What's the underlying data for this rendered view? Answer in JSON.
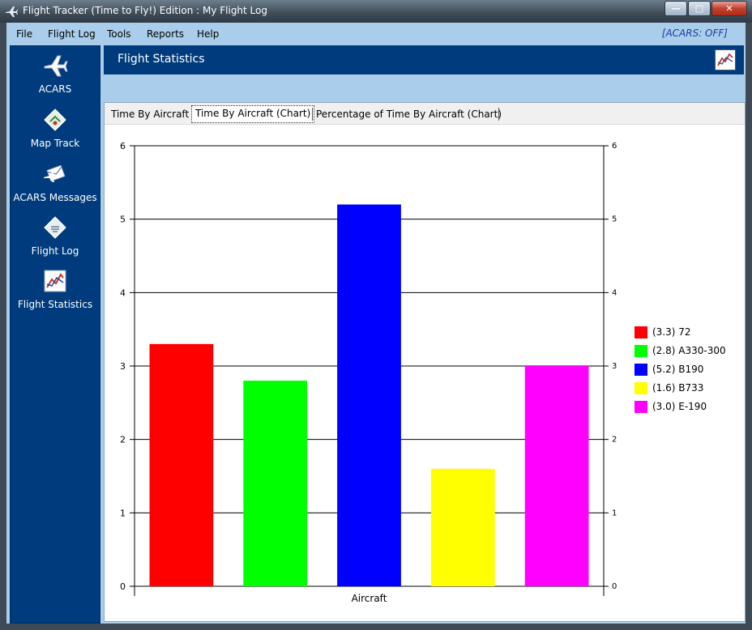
{
  "window": {
    "title": "Flight Tracker (Time to Fly!) Edition : My Flight Log",
    "controls": [
      "minimize-icon",
      "maximize-icon",
      "close-icon"
    ]
  },
  "menu": {
    "items": [
      "File",
      "Flight Log",
      "Tools",
      "Reports",
      "Help"
    ],
    "status": "[ACARS: OFF]"
  },
  "sidebar": {
    "items": [
      {
        "label": "ACARS",
        "icon": "airplane-icon"
      },
      {
        "label": "Map Track",
        "icon": "map-icon"
      },
      {
        "label": "ACARS Messages",
        "icon": "messages-icon"
      },
      {
        "label": "Flight Log",
        "icon": "logbook-icon"
      },
      {
        "label": "Flight Statistics",
        "icon": "chart-icon"
      }
    ]
  },
  "header": {
    "title": "Flight Statistics",
    "icon": "chart-icon"
  },
  "tabs": [
    "Time By Aircraft",
    "Time By Aircraft (Chart)",
    "Percentage of Time By Aircraft (Chart)"
  ],
  "active_tab": "Time By Aircraft (Chart)",
  "chart_data": {
    "type": "bar",
    "categories": [
      "72",
      "A330-300",
      "B190",
      "B733",
      "E-190"
    ],
    "values": [
      3.3,
      2.8,
      5.2,
      1.6,
      3.0
    ],
    "colors": [
      "#ff0000",
      "#00ff00",
      "#0000ff",
      "#ffff00",
      "#ff00ff"
    ],
    "legend": [
      "(3.3)  72",
      "(2.8)  A330-300",
      "(5.2)  B190",
      "(1.6)  B733",
      "(3.0)  E-190"
    ],
    "xlabel": "Aircraft",
    "ylabel": "",
    "ylim": [
      0,
      6
    ],
    "yticks": [
      "0",
      "1",
      "2",
      "3",
      "4",
      "5",
      "6"
    ],
    "grid": true,
    "legend_position": "right"
  }
}
